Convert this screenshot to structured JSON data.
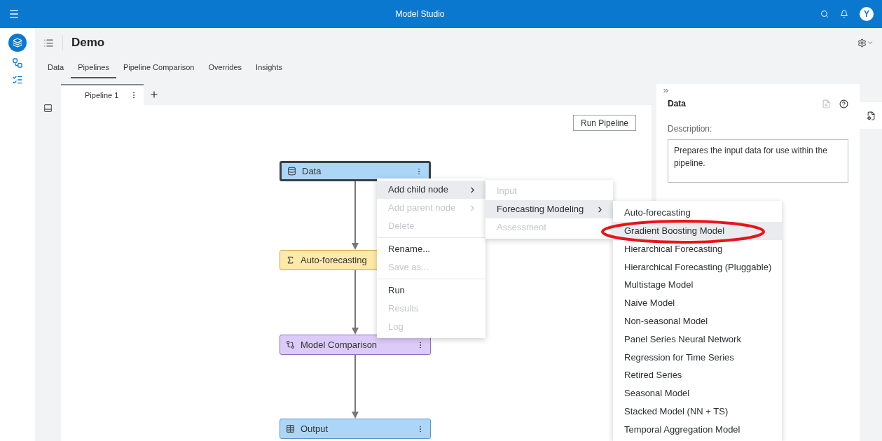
{
  "app_bar": {
    "title": "Model Studio",
    "avatar": "Y"
  },
  "project": {
    "title": "Demo"
  },
  "tabs": [
    {
      "label": "Data",
      "selected": false
    },
    {
      "label": "Pipelines",
      "selected": true
    },
    {
      "label": "Pipeline Comparison",
      "selected": false
    },
    {
      "label": "Overrides",
      "selected": false
    },
    {
      "label": "Insights",
      "selected": false
    }
  ],
  "pipeline_tabs": [
    {
      "label": "Pipeline 1",
      "selected": true
    }
  ],
  "run_button": "Run Pipeline",
  "nodes": [
    {
      "label": "Data",
      "kind": "data",
      "selected": true
    },
    {
      "label": "Auto-forecasting",
      "kind": "forecast",
      "selected": false
    },
    {
      "label": "Model Comparison",
      "kind": "compare",
      "selected": false
    },
    {
      "label": "Output",
      "kind": "output",
      "selected": false
    }
  ],
  "context_menu": {
    "groups": [
      [
        {
          "label": "Add child node",
          "disabled": false,
          "highlighted": true,
          "has_submenu": true
        },
        {
          "label": "Add parent node",
          "disabled": true,
          "highlighted": false,
          "has_submenu": true
        },
        {
          "label": "Delete",
          "disabled": true,
          "highlighted": false,
          "has_submenu": false
        }
      ],
      [
        {
          "label": "Rename...",
          "disabled": false,
          "highlighted": false,
          "has_submenu": false
        },
        {
          "label": "Save as...",
          "disabled": true,
          "highlighted": false,
          "has_submenu": false
        }
      ],
      [
        {
          "label": "Run",
          "disabled": false,
          "highlighted": false,
          "has_submenu": false
        },
        {
          "label": "Results",
          "disabled": true,
          "highlighted": false,
          "has_submenu": false
        },
        {
          "label": "Log",
          "disabled": true,
          "highlighted": false,
          "has_submenu": false
        }
      ]
    ]
  },
  "category_menu": {
    "items": [
      {
        "label": "Input",
        "disabled": true,
        "highlighted": false,
        "has_submenu": false
      },
      {
        "label": "Forecasting Modeling",
        "disabled": false,
        "highlighted": true,
        "has_submenu": true
      },
      {
        "label": "Assessment",
        "disabled": true,
        "highlighted": false,
        "has_submenu": false
      }
    ]
  },
  "node_menu": {
    "items": [
      {
        "label": "Auto-forecasting",
        "highlighted": false
      },
      {
        "label": "Gradient Boosting Model",
        "highlighted": true
      },
      {
        "label": "Hierarchical Forecasting",
        "highlighted": false
      },
      {
        "label": "Hierarchical Forecasting (Pluggable)",
        "highlighted": false
      },
      {
        "label": "Multistage Model",
        "highlighted": false
      },
      {
        "label": "Naive Model",
        "highlighted": false
      },
      {
        "label": "Non-seasonal Model",
        "highlighted": false
      },
      {
        "label": "Panel Series Neural Network",
        "highlighted": false
      },
      {
        "label": "Regression for Time Series",
        "highlighted": false
      },
      {
        "label": "Retired Series",
        "highlighted": false
      },
      {
        "label": "Seasonal Model",
        "highlighted": false
      },
      {
        "label": "Stacked Model (NN + TS)",
        "highlighted": false
      },
      {
        "label": "Temporal Aggregation Model",
        "highlighted": false
      }
    ]
  },
  "properties_panel": {
    "title": "Data",
    "description_label": "Description:",
    "description": "Prepares the input data for use within the pipeline."
  }
}
